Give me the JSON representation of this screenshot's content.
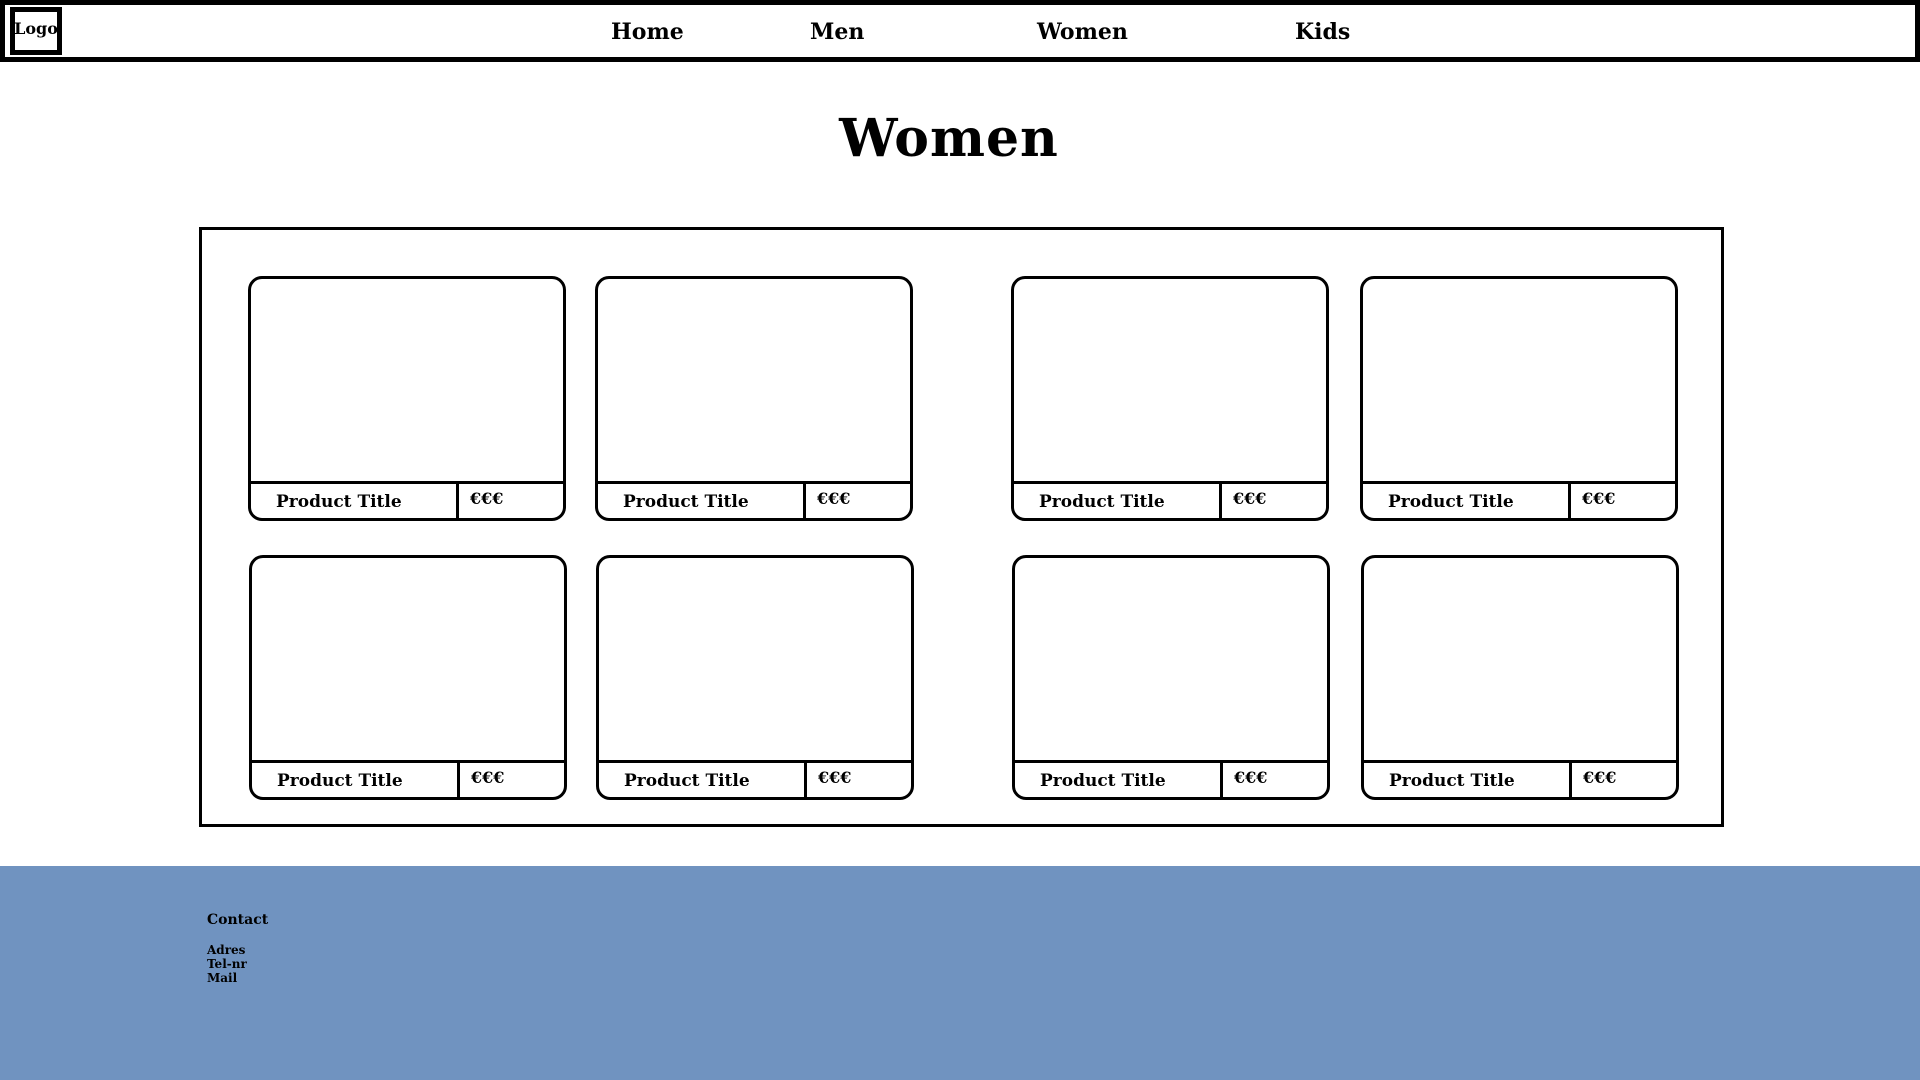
{
  "header": {
    "logo_label": "Logo",
    "nav": {
      "home": "Home",
      "men": "Men",
      "women": "Women",
      "kids": "Kids"
    }
  },
  "page": {
    "title": "Women"
  },
  "products": [
    {
      "title": "Product Title",
      "price": "€€€"
    },
    {
      "title": "Product Title",
      "price": "€€€"
    },
    {
      "title": "Product Title",
      "price": "€€€"
    },
    {
      "title": "Product Title",
      "price": "€€€"
    },
    {
      "title": "Product Title",
      "price": "€€€"
    },
    {
      "title": "Product Title",
      "price": "€€€"
    },
    {
      "title": "Product Title",
      "price": "€€€"
    },
    {
      "title": "Product Title",
      "price": "€€€"
    }
  ],
  "footer": {
    "heading": "Contact",
    "adres": "Adres",
    "telnr": "Tel-nr",
    "mail": "Mail",
    "background_color": "#7093c0"
  }
}
